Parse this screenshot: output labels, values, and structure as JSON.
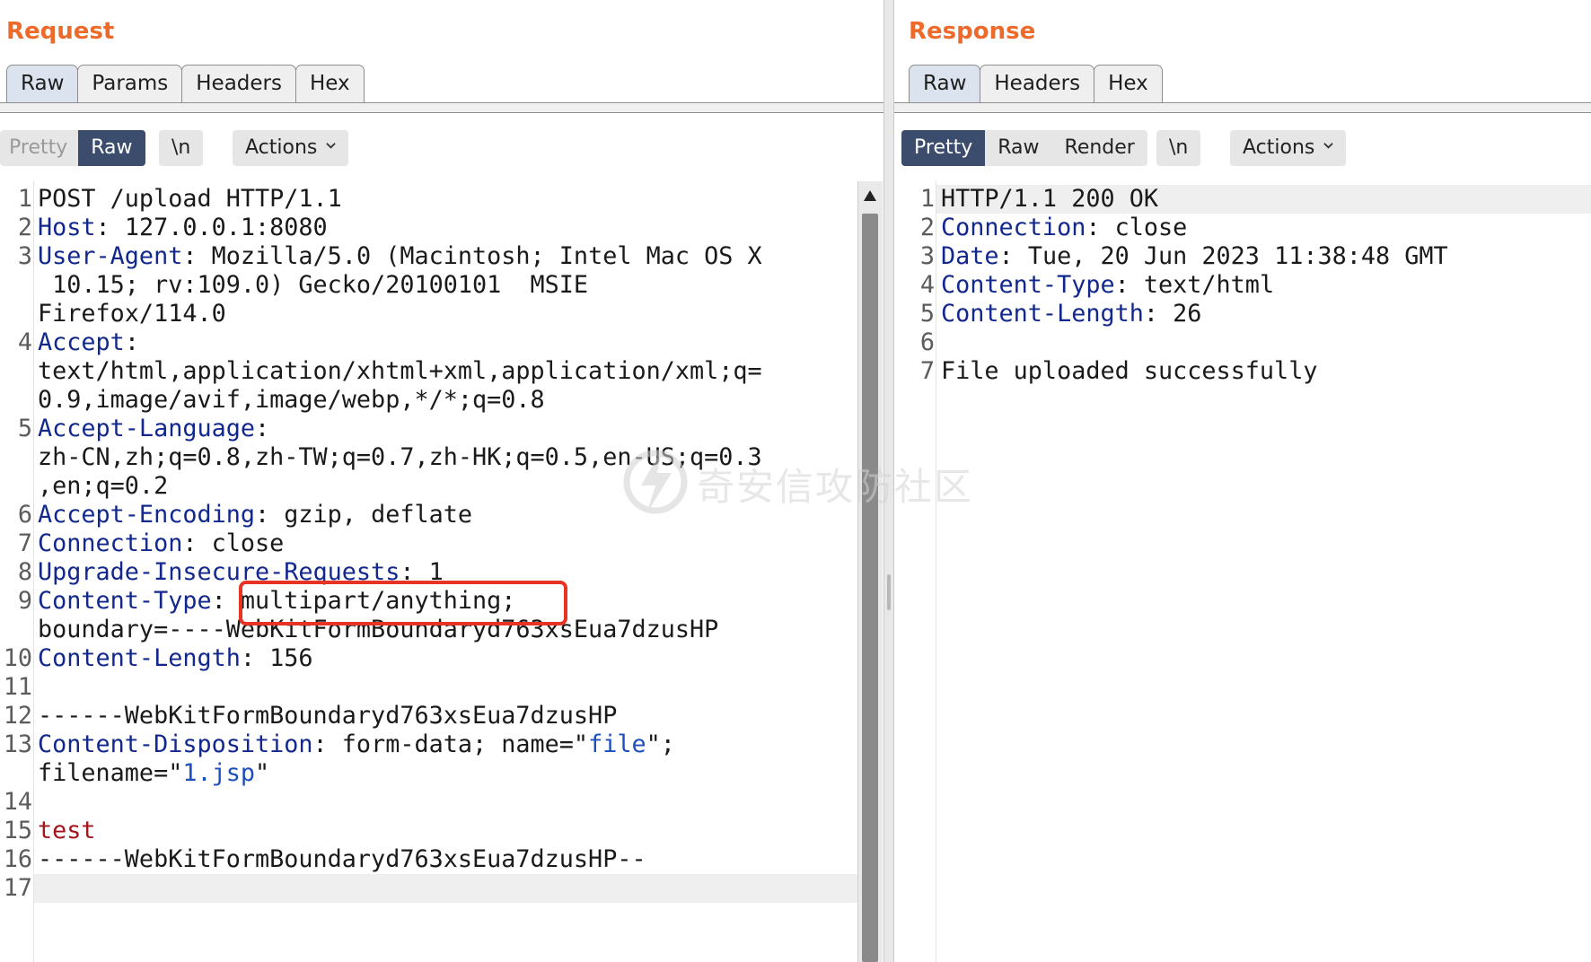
{
  "request": {
    "title": "Request",
    "tabs": [
      {
        "label": "Raw",
        "active": true
      },
      {
        "label": "Params",
        "active": false
      },
      {
        "label": "Headers",
        "active": false
      },
      {
        "label": "Hex",
        "active": false
      }
    ],
    "view_toggle": {
      "pretty": "Pretty",
      "raw": "Raw",
      "selected": "Raw"
    },
    "newline_label": "\\n",
    "actions_label": "Actions",
    "line_numbers": [
      "1",
      "2",
      "3",
      "4",
      "5",
      "6",
      "7",
      "8",
      "9",
      "10",
      "11",
      "12",
      "13",
      "14",
      "15",
      "16",
      "17"
    ],
    "lines": [
      {
        "text": "POST /upload HTTP/1.1"
      },
      {
        "key": "Host",
        "value": ": 127.0.0.1:8080"
      },
      {
        "key": "User-Agent",
        "value": ": Mozilla/5.0 (Macintosh; Intel Mac OS X",
        "cont1": " 10.15; rv:109.0) Gecko/20100101  MSIE",
        "cont2": "Firefox/114.0"
      },
      {
        "key": "Accept",
        "value": ":",
        "cont1": "text/html,application/xhtml+xml,application/xml;q=",
        "cont2": "0.9,image/avif,image/webp,*/*;q=0.8"
      },
      {
        "key": "Accept-Language",
        "value": ":",
        "cont1": "zh-CN,zh;q=0.8,zh-TW;q=0.7,zh-HK;q=0.5,en-US;q=0.3",
        "cont2": ",en;q=0.2"
      },
      {
        "key": "Accept-Encoding",
        "value": ": gzip, deflate"
      },
      {
        "key": "Connection",
        "value": ": close"
      },
      {
        "key": "Upgrade-Insecure-Requests",
        "value": ": 1"
      },
      {
        "key": "Content-Type",
        "value": ": multipart/anything;",
        "cont1": "boundary=----WebKitFormBoundaryd763xsEua7dzusHP"
      },
      {
        "key": "Content-Length",
        "value": ": 156"
      },
      {
        "text": ""
      },
      {
        "text": "------WebKitFormBoundaryd763xsEua7dzusHP"
      },
      {
        "key": "Content-Disposition",
        "value": ": form-data; name=\"",
        "str1": "file",
        "mid": "\";",
        "cont_pre": "filename=\"",
        "str2": "1.jsp",
        "cont_post": "\""
      },
      {
        "text": ""
      },
      {
        "body": "test"
      },
      {
        "text": "------WebKitFormBoundaryd763xsEua7dzusHP--"
      },
      {
        "text": ""
      }
    ]
  },
  "response": {
    "title": "Response",
    "tabs": [
      {
        "label": "Raw",
        "active": true
      },
      {
        "label": "Headers",
        "active": false
      },
      {
        "label": "Hex",
        "active": false
      }
    ],
    "view_toggle": {
      "pretty": "Pretty",
      "raw": "Raw",
      "render": "Render",
      "selected": "Pretty"
    },
    "newline_label": "\\n",
    "actions_label": "Actions",
    "line_numbers": [
      "1",
      "2",
      "3",
      "4",
      "5",
      "6",
      "7"
    ],
    "lines": [
      {
        "text": "HTTP/1.1 200 OK"
      },
      {
        "key": "Connection",
        "value": ": close"
      },
      {
        "key": "Date",
        "value": ": Tue, 20 Jun 2023 11:38:48 GMT"
      },
      {
        "key": "Content-Type",
        "value": ": text/html"
      },
      {
        "key": "Content-Length",
        "value": ": 26"
      },
      {
        "text": ""
      },
      {
        "text": "File uploaded successfully"
      }
    ]
  },
  "watermark": {
    "text": "奇安信攻防社区"
  },
  "colors": {
    "title": "#ee6a2a",
    "header_key": "#13288e",
    "string": "#1c4fbd",
    "body": "#a3141c",
    "selected_toggle": "#3b4c6c",
    "highlight_box": "#e63323"
  }
}
